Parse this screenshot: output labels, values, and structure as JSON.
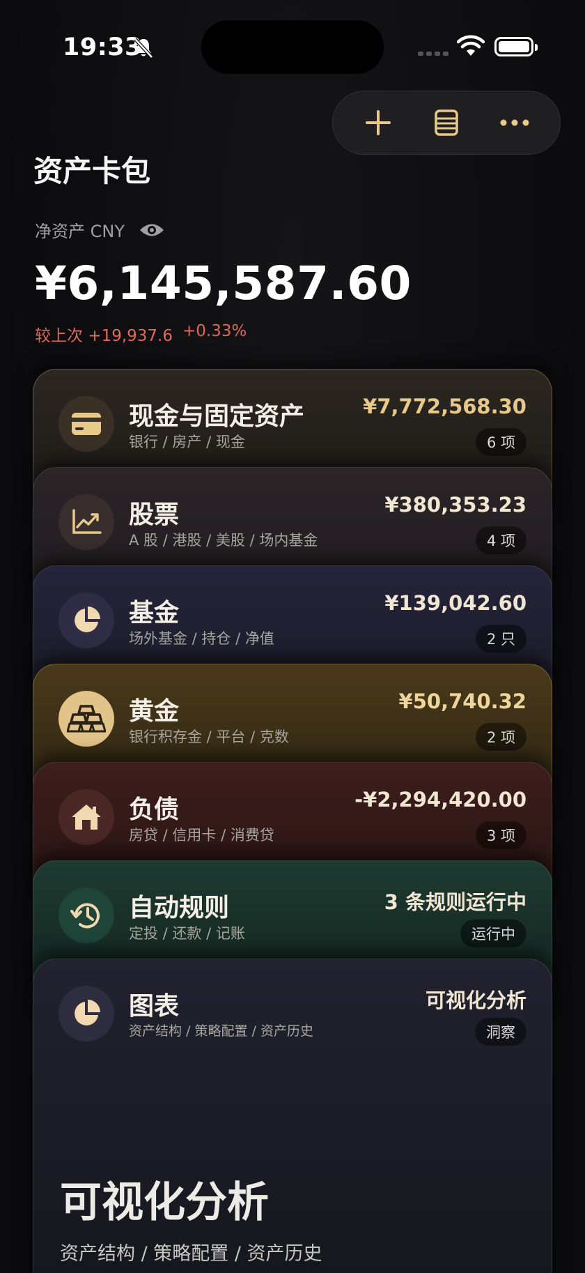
{
  "status_bar": {
    "time": "19:33"
  },
  "toolbar": {
    "add_icon": "plus-icon",
    "list_icon": "stack-icon",
    "more_icon": "ellipsis-icon"
  },
  "header": {
    "title": "资产卡包"
  },
  "summary": {
    "net_label": "净资产 CNY",
    "net_value": "¥6,145,587.60",
    "change_label": "较上次",
    "change_amount": "+19,937.6",
    "change_percent": "+0.33%"
  },
  "cards": [
    {
      "title": "现金与固定资产",
      "subtitle": "银行 / 房产 / 现金",
      "amount": "¥7,772,568.30",
      "badge": "6 项",
      "icon": "card-icon"
    },
    {
      "title": "股票",
      "subtitle": "A 股 / 港股 / 美股 / 场内基金",
      "amount": "¥380,353.23",
      "badge": "4 项",
      "icon": "trend-chart-icon"
    },
    {
      "title": "基金",
      "subtitle": "场外基金 / 持仓 / 净值",
      "amount": "¥139,042.60",
      "badge": "2 只",
      "icon": "pie-chart-icon"
    },
    {
      "title": "黄金",
      "subtitle": "银行积存金 / 平台 / 克数",
      "amount": "¥50,740.32",
      "badge": "2 项",
      "icon": "gold-bars-icon"
    },
    {
      "title": "负债",
      "subtitle": "房贷 / 信用卡 / 消费贷",
      "amount": "-¥2,294,420.00",
      "badge": "3 项",
      "icon": "house-icon"
    },
    {
      "title": "自动规则",
      "subtitle": "定投 / 还款 / 记账",
      "amount": "3 条规则运行中",
      "badge": "运行中",
      "icon": "history-icon"
    },
    {
      "title": "图表",
      "subtitle": "资产结构 / 策略配置 / 资产历史",
      "amount": "可视化分析",
      "badge": "洞察",
      "icon": "pie-chart-icon",
      "hero_title": "可视化分析",
      "hero_subtitle": "资产结构 / 策略配置 / 资产历史"
    }
  ],
  "colors": {
    "accent_gold": "#e8c98a",
    "change_red": "#e0685a",
    "background": "#0c0c0e"
  }
}
